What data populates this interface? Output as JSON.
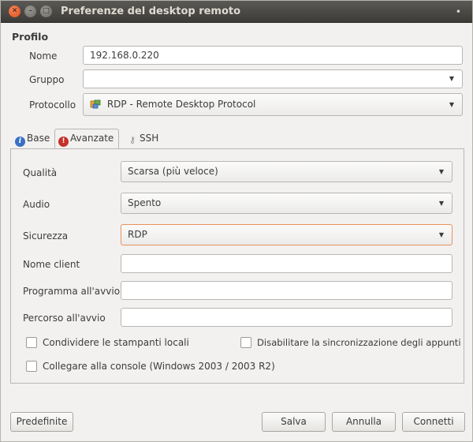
{
  "window": {
    "title": "Preferenze del desktop remoto",
    "menu_symbol": "•"
  },
  "profile": {
    "section_title": "Profilo",
    "name_label": "Nome",
    "name_value": "192.168.0.220",
    "group_label": "Gruppo",
    "group_value": "",
    "protocol_label": "Protocollo",
    "protocol_value": "RDP - Remote Desktop Protocol",
    "protocol_icon": "rdp-plugin-icon"
  },
  "tabs": [
    {
      "label": "Base",
      "icon": "info-icon",
      "active": false
    },
    {
      "label": "Avanzate",
      "icon": "warning-icon",
      "active": true
    },
    {
      "label": "SSH",
      "icon": "key-icon",
      "active": false
    }
  ],
  "advanced": {
    "quality_label": "Qualità",
    "quality_value": "Scarsa (più veloce)",
    "audio_label": "Audio",
    "audio_value": "Spento",
    "security_label": "Sicurezza",
    "security_value": "RDP",
    "client_name_label": "Nome client",
    "client_name_value": "",
    "startup_program_label": "Programma all'avvio",
    "startup_program_value": "",
    "startup_path_label": "Percorso all'avvio",
    "startup_path_value": "",
    "share_printers_label": "Condividere le stampanti locali",
    "share_printers_checked": false,
    "disable_sync_label": "Disabilitare la sincronizzazione degli appunti",
    "disable_sync_checked": false,
    "console_label": "Collegare alla console (Windows 2003 / 2003 R2)",
    "console_checked": false
  },
  "buttons": {
    "defaults": "Predefinite",
    "save": "Salva",
    "cancel": "Annulla",
    "connect": "Connetti"
  },
  "colors": {
    "titlebar": "#3c3b37",
    "close_button": "#df4a16",
    "focus_border": "#e9915f",
    "window_bg": "#f2f1f0"
  }
}
